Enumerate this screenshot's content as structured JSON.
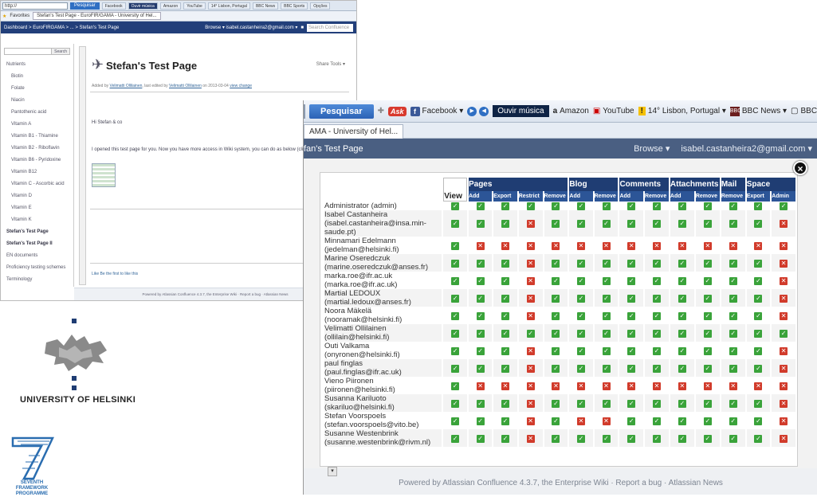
{
  "small_browser": {
    "address": "http://",
    "search_button": "Pesquisar",
    "toolbar_items": [
      "Facebook",
      "Ouvir música",
      "Amazon",
      "YouTube",
      "14° Lisbon, Portugal",
      "BBC News",
      "BBC Sports",
      "Opções"
    ],
    "favorites_label": "Favorites",
    "tab_title": "Stefan's Test Page - EuroFIR/GAMA - University of Hel...",
    "breadcrumb": "Dashboard > EuroFIRGAMA > ... > Stefan's Test Page",
    "nav_right": "Browse ▾   isabel.castanheira2@gmail.com ▾",
    "search_placeholder": "Search Confluence",
    "sidebar_search_button": "Search",
    "sidebar_items": [
      "Nutrients",
      "Biotin",
      "Folate",
      "Niacin",
      "Pantothenic acid",
      "Vitamin A",
      "Vitamin B1 - Thiamine",
      "Vitamin B2 - Riboflavin",
      "Vitamin B6 - Pyridoxine",
      "Vitamin B12",
      "Vitamin C - Ascorbic acid",
      "Vitamin D",
      "Vitamin E",
      "Vitamin K",
      "Stefan's Test Page",
      "Stefan's Test Page II",
      "EN documents",
      "Proficiency testing schemes",
      "Terminology"
    ],
    "page_title": "Stefan's Test Page",
    "share_tools": "Share   Tools ▾",
    "meta_prefix": "Added by",
    "meta_author": "Velimatti Ollilainen",
    "meta_middle": ", last edited by",
    "meta_editor": "Velimatti Ollilainen",
    "meta_date": "on 2013-03-04",
    "meta_link": "view change",
    "greeting": "Hi Stefan & co",
    "body_text": "I opened this test page for you. Now you have more access in Wiki system, you can do as below (click the picture)",
    "like_text": "Like   Be the first to like this",
    "footer": "Powered by Atlassian Confluence 4.3.7, the Enterprise Wiki  ·  Report a bug  ·  Atlassian News"
  },
  "logos": {
    "university": "UNIVERSITY OF HELSINKI",
    "fp7_line1": "SEVENTH FRAMEWORK",
    "fp7_line2": "PROGRAMME"
  },
  "big_browser": {
    "search_button": "Pesquisar",
    "ask_label": "Ask",
    "facebook": "Facebook ▾",
    "ouvir": "Ouvir música",
    "amazon": "Amazon",
    "youtube": "YouTube",
    "weather": "14° Lisbon, Portugal ▾",
    "bbc_news": "BBC News ▾",
    "bbc_sports": "BBC Sports ▾",
    "tab_title": "AMA - University of Hel...",
    "page_title": "fan's Test Page",
    "browse": "Browse ▾",
    "user": "isabel.castanheira2@gmail.com ▾",
    "close": "×",
    "footer": "Powered by Atlassian Confluence 4.3.7, the Enterprise Wiki  ·  Report a bug  ·  Atlassian News"
  },
  "permissions": {
    "view_label": "View",
    "groups": [
      {
        "name": "Pages",
        "span": 4
      },
      {
        "name": "Blog",
        "span": 2
      },
      {
        "name": "Comments",
        "span": 2
      },
      {
        "name": "Attachments",
        "span": 2
      },
      {
        "name": "Mail",
        "span": 1
      },
      {
        "name": "Space",
        "span": 2
      }
    ],
    "sub_columns": [
      "Add",
      "Export",
      "Restrict",
      "Remove",
      "Add",
      "Remove",
      "Add",
      "Remove",
      "Add",
      "Remove",
      "Remove",
      "Export",
      "Admin"
    ],
    "rows": [
      {
        "user": "Administrator (admin)",
        "p": [
          1,
          1,
          1,
          1,
          1,
          1,
          1,
          1,
          1,
          1,
          1,
          1,
          1,
          1
        ]
      },
      {
        "user": "Isabel Castanheira (isabel.castanheira@insa.min-saude.pt)",
        "p": [
          1,
          1,
          1,
          0,
          1,
          1,
          1,
          1,
          1,
          1,
          1,
          1,
          1,
          0
        ]
      },
      {
        "user": "Minnamari Edelmann (jedelman@helsinki.fi)",
        "p": [
          1,
          0,
          0,
          0,
          0,
          0,
          0,
          0,
          0,
          0,
          0,
          0,
          0,
          0
        ]
      },
      {
        "user": "Marine Oseredczuk (marine.oseredczuk@anses.fr)",
        "p": [
          1,
          1,
          1,
          0,
          1,
          1,
          1,
          1,
          1,
          1,
          1,
          1,
          1,
          0
        ]
      },
      {
        "user": "marka.roe@ifr.ac.uk (marka.roe@ifr.ac.uk)",
        "p": [
          1,
          1,
          1,
          0,
          1,
          1,
          1,
          1,
          1,
          1,
          1,
          1,
          1,
          0
        ]
      },
      {
        "user": "Martial LEDOUX (martial.ledoux@anses.fr)",
        "p": [
          1,
          1,
          1,
          0,
          1,
          1,
          1,
          1,
          1,
          1,
          1,
          1,
          1,
          0
        ]
      },
      {
        "user": "Noora Mäkelä (nooramak@helsinki.fi)",
        "p": [
          1,
          1,
          1,
          0,
          1,
          1,
          1,
          1,
          1,
          1,
          1,
          1,
          1,
          0
        ]
      },
      {
        "user": "Velimatti Ollilainen (ollilain@helsinki.fi)",
        "p": [
          1,
          1,
          1,
          1,
          1,
          1,
          1,
          1,
          1,
          1,
          1,
          1,
          1,
          1
        ]
      },
      {
        "user": "Outi Valkama (onyronen@helsinki.fi)",
        "p": [
          1,
          1,
          1,
          0,
          1,
          1,
          1,
          1,
          1,
          1,
          1,
          1,
          1,
          0
        ]
      },
      {
        "user": "paul finglas (paul.finglas@ifr.ac.uk)",
        "p": [
          1,
          1,
          1,
          0,
          1,
          1,
          1,
          1,
          1,
          1,
          1,
          1,
          1,
          0
        ]
      },
      {
        "user": "Vieno Piironen (piironen@helsinki.fi)",
        "p": [
          1,
          0,
          0,
          0,
          0,
          0,
          0,
          0,
          0,
          0,
          0,
          0,
          0,
          0
        ]
      },
      {
        "user": "Susanna Kariluoto (skariluo@helsinki.fi)",
        "p": [
          1,
          1,
          1,
          0,
          1,
          1,
          1,
          1,
          1,
          1,
          1,
          1,
          1,
          0
        ]
      },
      {
        "user": "Stefan Voorspoels (stefan.voorspoels@vito.be)",
        "p": [
          1,
          1,
          1,
          0,
          1,
          0,
          0,
          1,
          1,
          1,
          1,
          1,
          1,
          0
        ]
      },
      {
        "user": "Susanne Westenbrink (susanne.westenbrink@rivm.nl)",
        "p": [
          1,
          1,
          1,
          0,
          1,
          1,
          1,
          1,
          1,
          1,
          1,
          1,
          1,
          0
        ]
      }
    ]
  },
  "colors": {
    "allowed": "#3aa33a",
    "denied": "#d13b2b",
    "header": "#1f3d73",
    "subheader": "#2c5597"
  }
}
